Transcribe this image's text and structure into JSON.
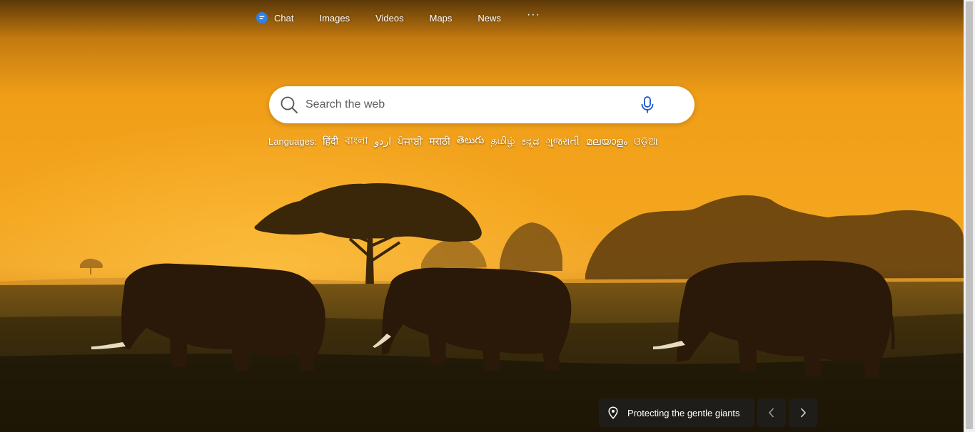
{
  "nav": {
    "items": [
      {
        "label": "Chat",
        "icon": "chat-icon"
      },
      {
        "label": "Images"
      },
      {
        "label": "Videos"
      },
      {
        "label": "Maps"
      },
      {
        "label": "News"
      }
    ],
    "more": "···"
  },
  "search": {
    "placeholder": "Search the web",
    "value": "",
    "icon": "search-icon",
    "mic_icon": "microphone-icon"
  },
  "languages": {
    "label": "Languages:",
    "links": [
      "हिंदी",
      "বাংলা",
      "اردو",
      "ਪੰਜਾਬੀ",
      "मराठी",
      "తెలుగు",
      "தமிழ்",
      "ಕನ್ನಡ",
      "ગુજરાતી",
      "മലയാളം",
      "ଓଡ଼ିଆ"
    ]
  },
  "caption": {
    "text": "Protecting the gentle giants",
    "icon": "location-pin-icon"
  },
  "controls": {
    "prev_icon": "chevron-left-icon",
    "next_icon": "chevron-right-icon"
  },
  "colors": {
    "sky_top": "#7a4a0c",
    "sky_mid": "#f2a31c",
    "horizon": "#f6b02a",
    "ground": "#2a1a08",
    "chat_icon": "#2b82e8",
    "mic_icon": "#1a56c9"
  }
}
